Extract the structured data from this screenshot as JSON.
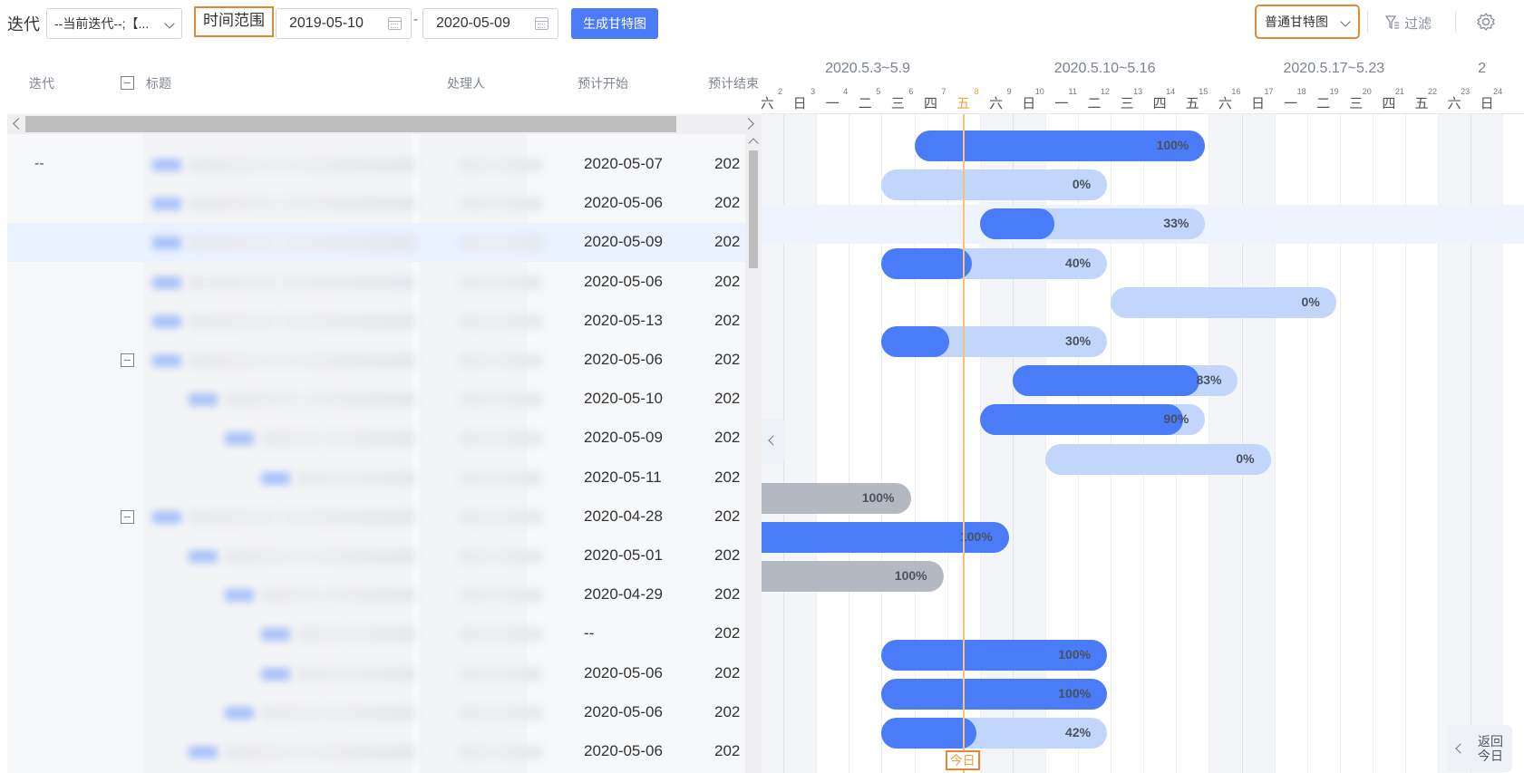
{
  "toolbar": {
    "iteration_label": "迭代",
    "iteration_select": "--当前迭代--;【...",
    "time_range_label": "时间范围",
    "start_date": "2019-05-10",
    "date_separator": "-",
    "end_date": "2020-05-09",
    "generate_button": "生成甘特图",
    "view_select": "普通甘特图",
    "filter_label": "过滤"
  },
  "table": {
    "columns": {
      "iteration": "迭代",
      "title": "标题",
      "assignee": "处理人",
      "planned_start": "预计开始",
      "planned_end": "预计结束"
    },
    "rows": [
      {
        "iteration": "--",
        "start": "2020-05-07",
        "end": "202"
      },
      {
        "iteration": "",
        "start": "2020-05-06",
        "end": "202"
      },
      {
        "iteration": "",
        "start": "2020-05-09",
        "end": "202"
      },
      {
        "iteration": "",
        "start": "2020-05-06",
        "end": "202"
      },
      {
        "iteration": "",
        "start": "2020-05-13",
        "end": "202"
      },
      {
        "iteration": "",
        "start": "2020-05-06",
        "end": "202"
      },
      {
        "iteration": "",
        "start": "2020-05-10",
        "end": "202"
      },
      {
        "iteration": "",
        "start": "2020-05-09",
        "end": "202"
      },
      {
        "iteration": "",
        "start": "2020-05-11",
        "end": "202"
      },
      {
        "iteration": "",
        "start": "2020-04-28",
        "end": "202"
      },
      {
        "iteration": "",
        "start": "2020-05-01",
        "end": "202"
      },
      {
        "iteration": "",
        "start": "2020-04-29",
        "end": "202"
      },
      {
        "iteration": "",
        "start": "--",
        "end": "202"
      },
      {
        "iteration": "",
        "start": "2020-05-06",
        "end": "202"
      },
      {
        "iteration": "",
        "start": "2020-05-06",
        "end": "202"
      },
      {
        "iteration": "",
        "start": "2020-05-06",
        "end": "202"
      }
    ]
  },
  "gantt": {
    "weeks": [
      "2020.5.3~5.9",
      "2020.5.10~5.16",
      "2020.5.17~5.23",
      "2"
    ],
    "days": [
      {
        "name": "六",
        "num": "2"
      },
      {
        "name": "日",
        "num": "3"
      },
      {
        "name": "一",
        "num": "4"
      },
      {
        "name": "二",
        "num": "5"
      },
      {
        "name": "三",
        "num": "6"
      },
      {
        "name": "四",
        "num": "7"
      },
      {
        "name": "五",
        "num": "8"
      },
      {
        "name": "六",
        "num": "9"
      },
      {
        "name": "日",
        "num": "10"
      },
      {
        "name": "一",
        "num": "11"
      },
      {
        "name": "二",
        "num": "12"
      },
      {
        "name": "三",
        "num": "13"
      },
      {
        "name": "四",
        "num": "14"
      },
      {
        "name": "五",
        "num": "15"
      },
      {
        "name": "六",
        "num": "16"
      },
      {
        "name": "日",
        "num": "17"
      },
      {
        "name": "一",
        "num": "18"
      },
      {
        "name": "二",
        "num": "19"
      },
      {
        "name": "三",
        "num": "20"
      },
      {
        "name": "四",
        "num": "21"
      },
      {
        "name": "五",
        "num": "22"
      },
      {
        "name": "六",
        "num": "23"
      },
      {
        "name": "日",
        "num": "24"
      }
    ],
    "today_label": "今日",
    "back_today": "返回今日",
    "colors": {
      "primary": "#4a7cf7",
      "light": "#c2d5fb",
      "done_gray": "#b4b9c1",
      "today": "#f0a13c",
      "highlight_box": "#e8872f"
    },
    "bars": [
      {
        "start": "2020-05-07",
        "end": "2020-05-15",
        "progress": 100,
        "pct_label": "100%",
        "style": "blue"
      },
      {
        "start": "2020-05-06",
        "end": "2020-05-12",
        "progress": 0,
        "pct_label": "0%",
        "style": "blue"
      },
      {
        "start": "2020-05-09",
        "end": "2020-05-15",
        "progress": 33,
        "pct_label": "33%",
        "style": "blue"
      },
      {
        "start": "2020-05-06",
        "end": "2020-05-12",
        "progress": 40,
        "pct_label": "40%",
        "style": "blue"
      },
      {
        "start": "2020-05-13",
        "end": "2020-05-19",
        "progress": 0,
        "pct_label": "0%",
        "style": "blue"
      },
      {
        "start": "2020-05-06",
        "end": "2020-05-12",
        "progress": 30,
        "pct_label": "30%",
        "style": "blue"
      },
      {
        "start": "2020-05-10",
        "end": "2020-05-16",
        "progress": 83,
        "pct_label": "83%",
        "style": "blue"
      },
      {
        "start": "2020-05-09",
        "end": "2020-05-15",
        "progress": 90,
        "pct_label": "90%",
        "style": "blue"
      },
      {
        "start": "2020-05-11",
        "end": "2020-05-17",
        "progress": 0,
        "pct_label": "0%",
        "style": "blue"
      },
      {
        "start": "2020-04-28",
        "end": "2020-05-06",
        "progress": 100,
        "pct_label": "100%",
        "style": "gray"
      },
      {
        "start": "2020-05-01",
        "end": "2020-05-09",
        "progress": 100,
        "pct_label": "100%",
        "style": "blue"
      },
      {
        "start": "2020-04-29",
        "end": "2020-05-07",
        "progress": 100,
        "pct_label": "100%",
        "style": "gray"
      },
      null,
      {
        "start": "2020-05-06",
        "end": "2020-05-12",
        "progress": 100,
        "pct_label": "100%",
        "style": "blue"
      },
      {
        "start": "2020-05-06",
        "end": "2020-05-12",
        "progress": 100,
        "pct_label": "100%",
        "style": "blue"
      },
      {
        "start": "2020-05-06",
        "end": "2020-05-12",
        "progress": 42,
        "pct_label": "42%",
        "style": "blue"
      }
    ]
  }
}
